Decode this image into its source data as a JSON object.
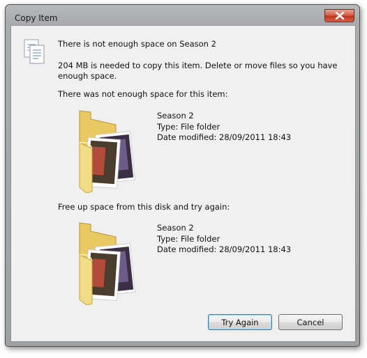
{
  "window": {
    "title": "Copy Item"
  },
  "dialog": {
    "main_message": "There is not enough space on Season 2",
    "detail_message": "204 MB is needed to copy this item. Delete or move files so you have enough space.",
    "section1_label": "There was not enough space for this item:",
    "section2_label": "Free up space from this disk and try again:",
    "items": [
      {
        "name": "Season 2",
        "type": "Type: File folder",
        "modified": "Date modified: 28/09/2011 18:43"
      },
      {
        "name": "Season 2",
        "type": "Type: File folder",
        "modified": "Date modified: 28/09/2011 18:43"
      }
    ]
  },
  "buttons": {
    "try_again": "Try Again",
    "cancel": "Cancel"
  },
  "icons": {
    "document": "copy-document-icon",
    "folder": "folder-icon",
    "close": "close-icon"
  },
  "colors": {
    "close_button": "#c7381f",
    "default_button_border": "#3c7fb1"
  }
}
